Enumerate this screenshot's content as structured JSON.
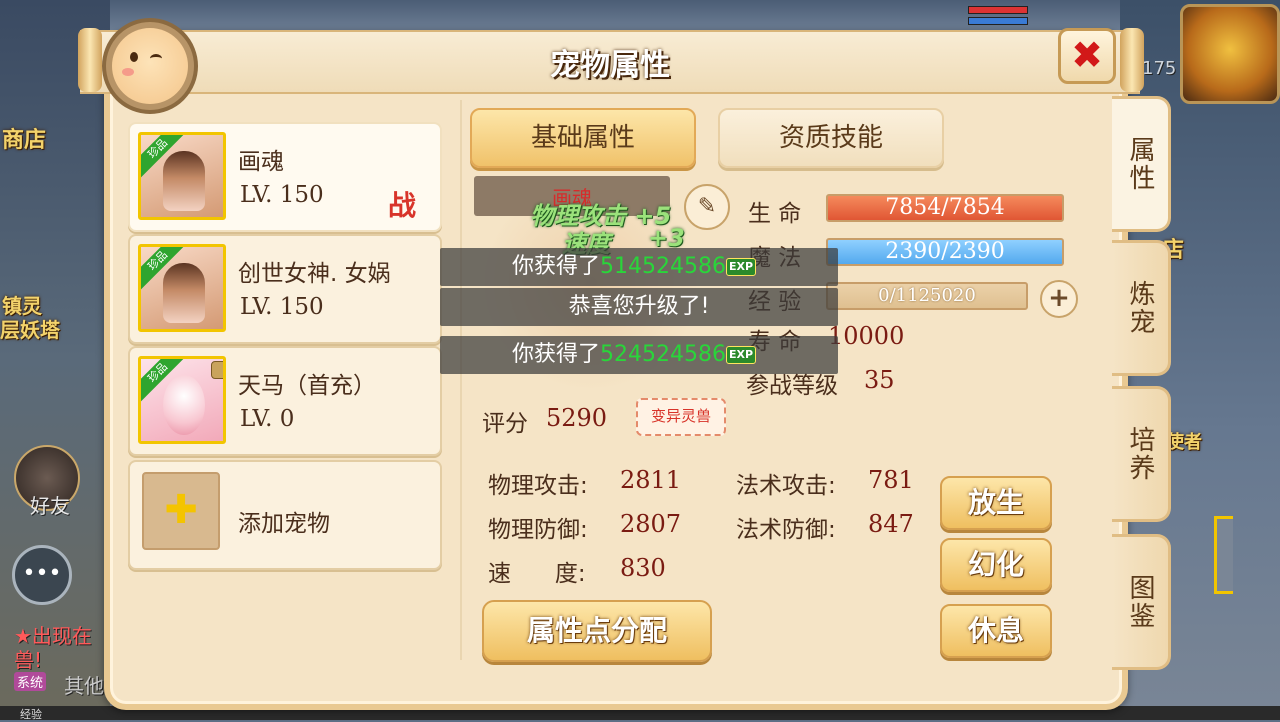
{
  "background": {
    "shop_label": "商店",
    "tower_label_1": "镇灵",
    "tower_label_2": "层妖塔",
    "friend_label": "好友",
    "right_label_1": "店",
    "right_label_2": "使者",
    "boss_level": "175",
    "chat_text_1": "★出现在",
    "chat_text_2": "兽!",
    "system_label": "系统",
    "system_text": "其他",
    "exp_label": "经验"
  },
  "window": {
    "title": "宠物属性",
    "close_icon": "✖"
  },
  "pets": [
    {
      "name": "画魂",
      "level": "LV. 150",
      "badge": "珍品",
      "battle": "战"
    },
    {
      "name": "创世女神. 女娲",
      "level": "LV. 150",
      "badge": "珍品"
    },
    {
      "name": "天马（首充）",
      "level": "LV. 0",
      "badge": "珍品"
    }
  ],
  "add_pet_label": "添加宠物",
  "tabs": {
    "basic": "基础属性",
    "qualification": "资质技能"
  },
  "model_name": "画魂",
  "float": {
    "attack": "物理攻击 +5",
    "speed_label": "速度",
    "speed_val": "+3"
  },
  "toasts": [
    {
      "prefix": "你获得了",
      "number": "514524586",
      "icon": "EXP"
    },
    {
      "text": "恭喜您升级了!"
    },
    {
      "prefix": "你获得了",
      "number": "524524586",
      "icon": "EXP"
    }
  ],
  "stats": {
    "life_label": "生  命",
    "life_value": "7854/7854",
    "mana_label": "魔  法",
    "mana_value": "2390/2390",
    "exp_label": "经  验",
    "exp_value": "0/1125020",
    "lifespan_label": "寿  命",
    "lifespan_value": "10000",
    "battle_level_label": "参战等级",
    "battle_level_value": "35",
    "score_label": "评分",
    "score_value": "5290",
    "mutate_badge": "变异灵兽",
    "phys_atk_label": "物理攻击:",
    "phys_atk": "2811",
    "phys_def_label": "物理防御:",
    "phys_def": "2807",
    "speed_label": "速      度:",
    "speed": "830",
    "mag_atk_label": "法术攻击:",
    "mag_atk": "781",
    "mag_def_label": "法术防御:",
    "mag_def": "847"
  },
  "buttons": {
    "allocate": "属性点分配",
    "release": "放生",
    "transform": "幻化",
    "rest": "休息"
  },
  "side_tabs": [
    "属性",
    "炼宠",
    "培养",
    "图鉴"
  ]
}
